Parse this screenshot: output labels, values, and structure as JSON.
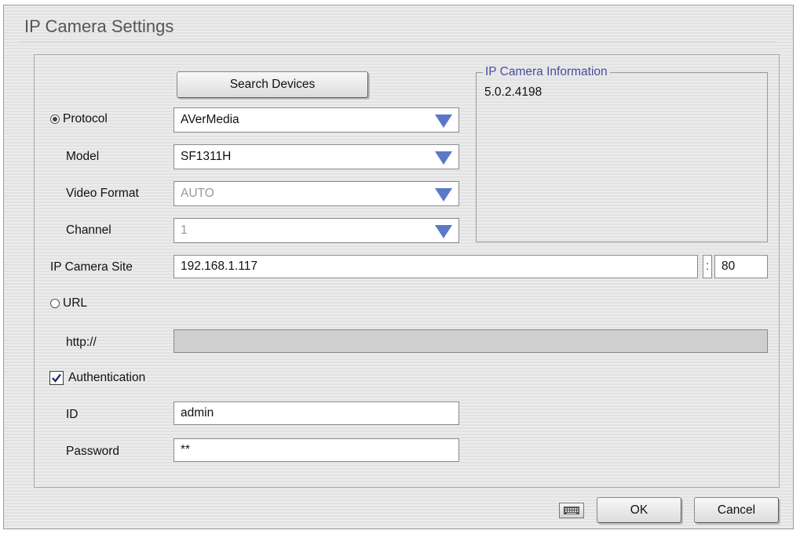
{
  "window": {
    "title": "IP Camera Settings"
  },
  "search_button": "Search Devices",
  "info": {
    "legend": "IP Camera Information",
    "version": "5.0.2.4198"
  },
  "protocol": {
    "label": "Protocol",
    "value": "AVerMedia",
    "selected": true
  },
  "model": {
    "label": "Model",
    "value": "SF1311H"
  },
  "video_format": {
    "label": "Video Format",
    "value": "AUTO"
  },
  "channel": {
    "label": "Channel",
    "value": "1"
  },
  "site": {
    "label": "IP Camera Site",
    "value": "192.168.1.117",
    "separator": ":",
    "port": "80"
  },
  "url": {
    "label": "URL",
    "prefix": "http://",
    "value": "",
    "selected": false
  },
  "auth": {
    "label": "Authentication",
    "checked": true
  },
  "id": {
    "label": "ID",
    "value": "admin"
  },
  "password": {
    "label": "Password",
    "value": "**"
  },
  "footer": {
    "keyboard_icon": "keyboard-icon",
    "ok": "OK",
    "cancel": "Cancel"
  },
  "colors": {
    "accent": "#5a78c8",
    "legend": "#4a4aa0"
  }
}
